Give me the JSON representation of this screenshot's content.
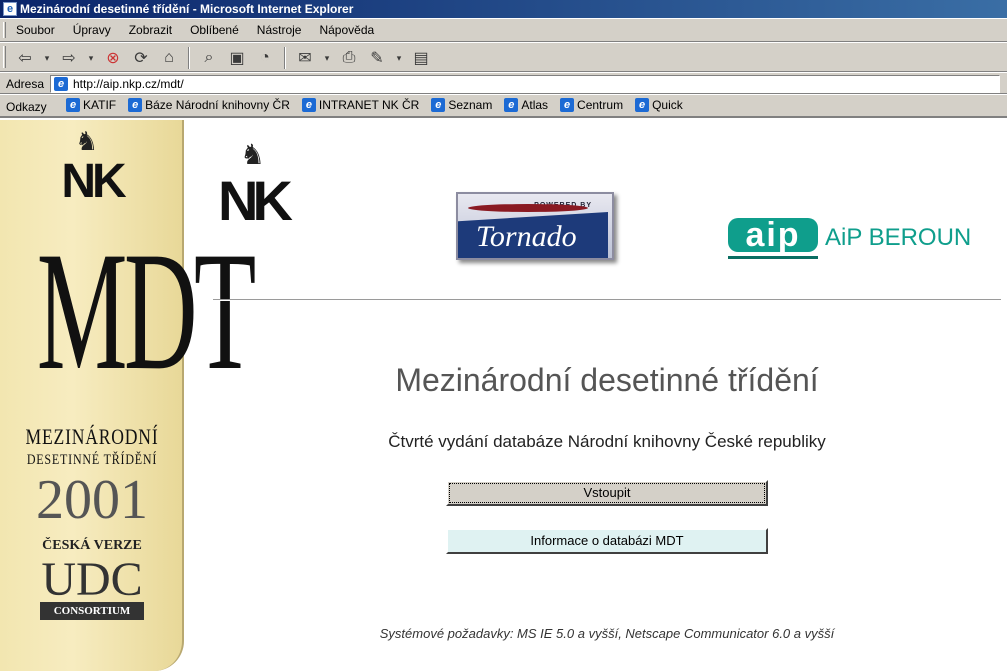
{
  "window": {
    "title": "Mezinárodní desetinné třídění - Microsoft Internet Explorer",
    "app_icon": "ie-icon"
  },
  "menu": {
    "items": [
      "Soubor",
      "Úpravy",
      "Zobrazit",
      "Oblíbené",
      "Nástroje",
      "Nápověda"
    ]
  },
  "toolbar": {
    "buttons": [
      "back-icon",
      "forward-icon",
      "stop-icon",
      "refresh-icon",
      "home-icon",
      "search-icon",
      "favorites-icon",
      "history-icon",
      "mail-icon",
      "print-icon",
      "edit-icon",
      "discuss-icon"
    ]
  },
  "address": {
    "label": "Adresa",
    "url": "http://aip.nkp.cz/mdt/"
  },
  "links": {
    "label": "Odkazy",
    "items": [
      "KATIF",
      "Báze Národní knihovny ČR",
      "INTRANET NK ČR",
      "Seznam",
      "Atlas",
      "Centrum",
      "Quick"
    ]
  },
  "banner": {
    "nk": "NK",
    "mdt": "MDT",
    "line1": "MEZINÁRODNÍ",
    "line2": "DESETINNÉ TŘÍDĚNÍ",
    "year": "2001",
    "edition": "ČESKÁ VERZE",
    "udc": "UDC",
    "consortium": "CONSORTIUM"
  },
  "logos": {
    "nk": "NK",
    "tornado_tag": "POWERED BY",
    "tornado": "Tornado",
    "aip_box": "aip",
    "aip_name": "AiP BEROUN"
  },
  "main": {
    "title": "Mezinárodní desetinné třídění",
    "subtitle": "Čtvrté vydání databáze Národní knihovny České republiky",
    "enter_button": "Vstoupit",
    "info_button": "Informace o databázi MDT",
    "requirements": "Systémové požadavky: MS IE 5.0 a vyšší, Netscape Communicator 6.0 a vyšší"
  }
}
